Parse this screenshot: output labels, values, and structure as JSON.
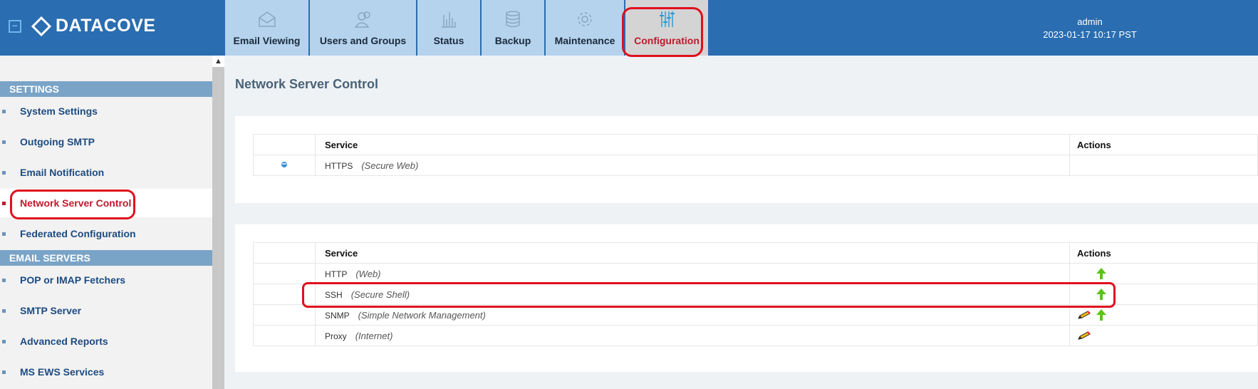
{
  "app": {
    "name": "DATACOVE"
  },
  "nav": {
    "tabs": [
      {
        "label": "Email Viewing",
        "icon": "envelope-icon"
      },
      {
        "label": "Users and Groups",
        "icon": "users-icon"
      },
      {
        "label": "Status",
        "icon": "bar-chart-icon"
      },
      {
        "label": "Backup",
        "icon": "database-icon"
      },
      {
        "label": "Maintenance",
        "icon": "gear-icon"
      },
      {
        "label": "Configuration",
        "icon": "sliders-icon",
        "active": true
      }
    ]
  },
  "user": {
    "name": "admin",
    "datetime": "2023-01-17 10:17 PST"
  },
  "sidebar": {
    "sections": [
      {
        "title": "SETTINGS",
        "items": [
          {
            "label": "System Settings"
          },
          {
            "label": "Outgoing SMTP"
          },
          {
            "label": "Email Notification"
          },
          {
            "label": "Network Server Control",
            "active": true
          },
          {
            "label": "Federated Configuration"
          }
        ]
      },
      {
        "title": "EMAIL SERVERS",
        "items": [
          {
            "label": "POP or IMAP Fetchers"
          },
          {
            "label": "SMTP Server"
          },
          {
            "label": "Advanced Reports"
          },
          {
            "label": "MS EWS Services"
          }
        ]
      }
    ]
  },
  "main": {
    "title": "Network Server Control",
    "secure_table": {
      "headers": {
        "service": "Service",
        "actions": "Actions"
      },
      "rows": [
        {
          "name": "HTTPS",
          "desc": "(Secure Web)",
          "status_icon": "server-status-icon"
        }
      ]
    },
    "services_table": {
      "headers": {
        "service": "Service",
        "actions": "Actions"
      },
      "rows": [
        {
          "name": "HTTP",
          "desc": "(Web)",
          "actions": [
            "start-arrow-icon"
          ]
        },
        {
          "name": "SSH",
          "desc": "(Secure Shell)",
          "actions": [
            "start-arrow-icon"
          ]
        },
        {
          "name": "SNMP",
          "desc": "(Simple Network Management)",
          "actions": [
            "edit-pencil-icon",
            "start-arrow-icon"
          ]
        },
        {
          "name": "Proxy",
          "desc": "(Internet)",
          "actions": [
            "edit-pencil-icon"
          ]
        }
      ]
    }
  },
  "colors": {
    "header": "#2a6db0",
    "tab": "#b6d3ee",
    "active_text": "#c0192c",
    "sidebar_section": "#7aa4c7",
    "arrow": "#5cc21e"
  }
}
